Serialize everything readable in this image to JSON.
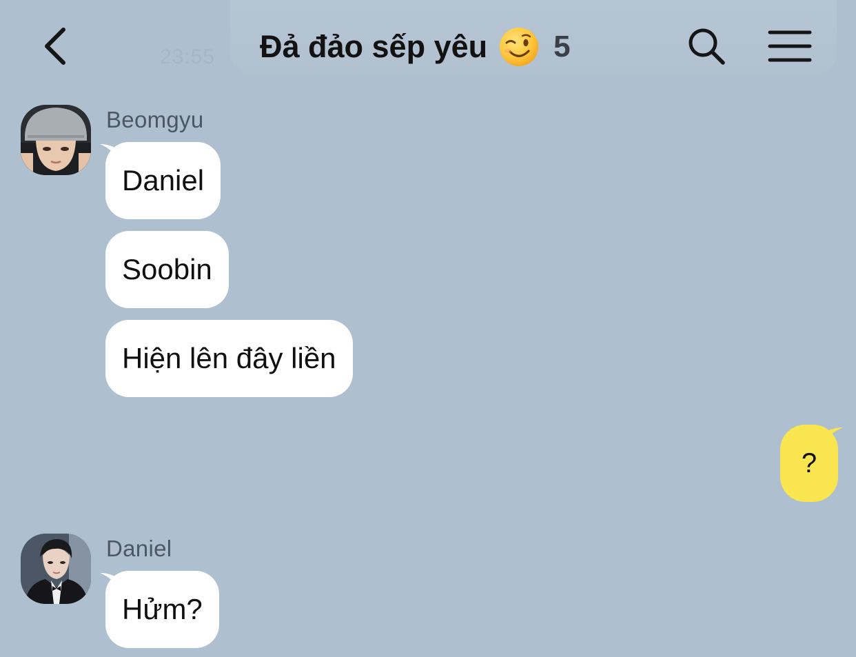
{
  "header": {
    "ghost_time": "23:55",
    "title": "Đả đảo sếp yêu",
    "title_emoji": "winking-face",
    "member_count": "5"
  },
  "messages": [
    {
      "sender": "Beomgyu",
      "bubbles": [
        "Daniel",
        "Soobin",
        "Hiện lên đây liền"
      ]
    },
    {
      "sender": "me",
      "bubbles": [
        "?"
      ]
    },
    {
      "sender": "Daniel",
      "bubbles": [
        "Hửm?"
      ]
    }
  ],
  "colors": {
    "background": "#aebfcf",
    "incoming_bubble": "#ffffff",
    "outgoing_bubble": "#f8e54f",
    "sender_name": "#4c5763"
  }
}
